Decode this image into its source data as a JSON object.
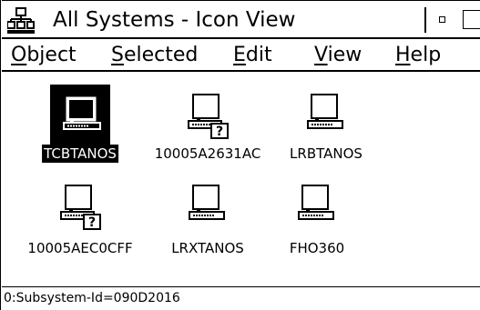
{
  "window": {
    "title": "All Systems - Icon View"
  },
  "menu": {
    "items": [
      {
        "first": "O",
        "rest": "bject"
      },
      {
        "first": "S",
        "rest": "elected"
      },
      {
        "first": "E",
        "rest": "dit"
      },
      {
        "first": "V",
        "rest": "iew"
      },
      {
        "first": "H",
        "rest": "elp"
      }
    ]
  },
  "systems": [
    {
      "name": "TCBTANOS",
      "selected": true,
      "unknown": false
    },
    {
      "name": "10005A2631AC",
      "selected": false,
      "unknown": true
    },
    {
      "name": "LRBTANOS",
      "selected": false,
      "unknown": false
    },
    {
      "name": "10005AEC0CFF",
      "selected": false,
      "unknown": true
    },
    {
      "name": "LRXTANOS",
      "selected": false,
      "unknown": false
    },
    {
      "name": "FHO360",
      "selected": false,
      "unknown": false
    }
  ],
  "status_bar": {
    "text": "0:Subsystem-Id=090D2016"
  }
}
